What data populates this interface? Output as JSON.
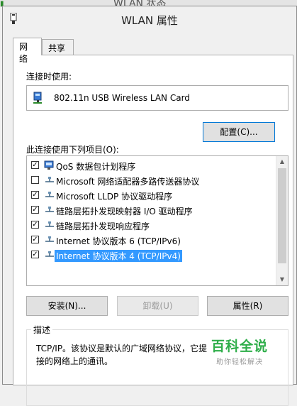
{
  "background_window": {
    "title": "WLAN 状态"
  },
  "dialog": {
    "title": "WLAN 属性",
    "tabs": [
      {
        "label": "网络",
        "active": true
      },
      {
        "label": "共享",
        "active": false
      }
    ],
    "connect_using_label": "连接时使用:",
    "adapter_name": "802.11n USB Wireless LAN Card",
    "configure_button": "配置(C)...",
    "items_label": "此连接使用下列项目(O):",
    "items": [
      {
        "label": "QoS 数据包计划程序",
        "checked": true,
        "icon": "qos-icon"
      },
      {
        "label": "Microsoft 网络适配器多路传送器协议",
        "checked": false,
        "icon": "protocol-icon"
      },
      {
        "label": "Microsoft LLDP 协议驱动程序",
        "checked": true,
        "icon": "protocol-icon"
      },
      {
        "label": "链路层拓扑发现映射器 I/O 驱动程序",
        "checked": true,
        "icon": "protocol-icon"
      },
      {
        "label": "链路层拓扑发现响应程序",
        "checked": true,
        "icon": "protocol-icon"
      },
      {
        "label": "Internet 协议版本 6 (TCP/IPv6)",
        "checked": true,
        "icon": "protocol-icon"
      },
      {
        "label": "Internet 协议版本 4 (TCP/IPv4)",
        "checked": true,
        "icon": "protocol-icon",
        "selected": true
      }
    ],
    "install_button": "安装(N)...",
    "uninstall_button": "卸载(U)",
    "properties_button": "属性(R)",
    "description_legend": "描述",
    "description_text": "TCP/IP。该协议是默认的广域网络协议，它提供在不同的相互连接的网络上的通讯。",
    "description_line1": "TCP/IP。该协议是默认的广域网络协议，它提",
    "description_line2": "接的网络上的通讯。"
  },
  "watermark": {
    "main": "百科全说",
    "sub": "助你轻松解决"
  },
  "colors": {
    "selection": "#3399ff",
    "focus_border": "#0078d7",
    "watermark": "#2fae4a"
  }
}
